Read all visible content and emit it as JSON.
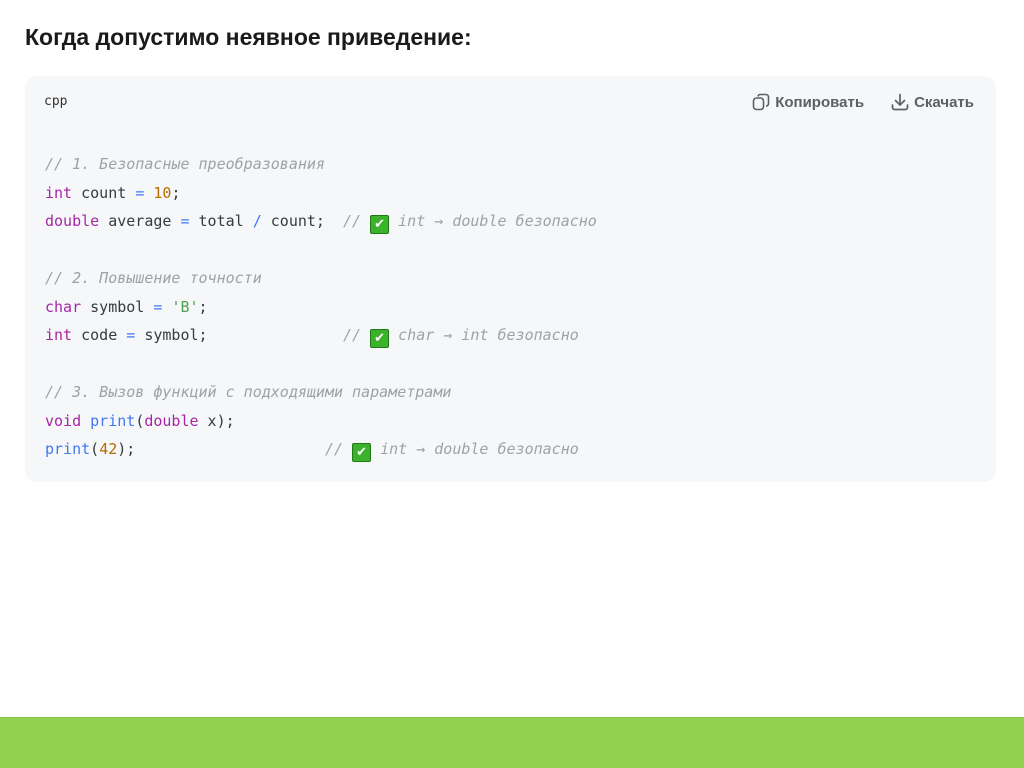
{
  "heading": "Когда допустимо неявное приведение:",
  "code_block": {
    "language": "cpp",
    "copy_label": "Копировать",
    "download_label": "Скачать",
    "lines": [
      [
        [
          "cm",
          "// 1. Безопасные преобразования"
        ]
      ],
      [
        [
          "kw",
          "int"
        ],
        [
          "pl",
          " count "
        ],
        [
          "op",
          "="
        ],
        [
          "pl",
          " "
        ],
        [
          "num",
          "10"
        ],
        [
          "pl",
          ";"
        ]
      ],
      [
        [
          "kw",
          "double"
        ],
        [
          "pl",
          " average "
        ],
        [
          "op",
          "="
        ],
        [
          "pl",
          " total "
        ],
        [
          "op",
          "/"
        ],
        [
          "pl",
          " count;  "
        ],
        [
          "cm",
          "// "
        ],
        [
          "check",
          "✔"
        ],
        [
          "cm",
          " int → double безопасно"
        ]
      ],
      [],
      [
        [
          "cm",
          "// 2. Повышение точности"
        ]
      ],
      [
        [
          "kw",
          "char"
        ],
        [
          "pl",
          " symbol "
        ],
        [
          "op",
          "="
        ],
        [
          "pl",
          " "
        ],
        [
          "str",
          "'B'"
        ],
        [
          "pl",
          ";"
        ]
      ],
      [
        [
          "kw",
          "int"
        ],
        [
          "pl",
          " code "
        ],
        [
          "op",
          "="
        ],
        [
          "pl",
          " symbol;               "
        ],
        [
          "cm",
          "// "
        ],
        [
          "check",
          "✔"
        ],
        [
          "cm",
          " char → int безопасно"
        ]
      ],
      [],
      [
        [
          "cm",
          "// 3. Вызов функций с подходящими параметрами"
        ]
      ],
      [
        [
          "kw",
          "void"
        ],
        [
          "pl",
          " "
        ],
        [
          "fn",
          "print"
        ],
        [
          "pl",
          "("
        ],
        [
          "kw",
          "double"
        ],
        [
          "pl",
          " x);"
        ]
      ],
      [
        [
          "fn",
          "print"
        ],
        [
          "pl",
          "("
        ],
        [
          "num",
          "42"
        ],
        [
          "pl",
          ");                     "
        ],
        [
          "cm",
          "// "
        ],
        [
          "check",
          "✔"
        ],
        [
          "cm",
          " int → double безопасно"
        ]
      ]
    ]
  },
  "colors": {
    "footer": "#92d050",
    "check": "#3bb12c"
  }
}
